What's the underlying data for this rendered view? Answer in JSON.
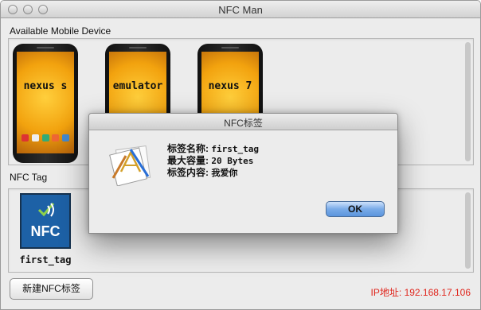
{
  "window": {
    "title": "NFC Man"
  },
  "devices": {
    "section_label": "Available Mobile Device",
    "items": [
      {
        "name": "nexus s"
      },
      {
        "name": "emulator"
      },
      {
        "name": "nexus 7"
      }
    ]
  },
  "tags": {
    "section_label": "NFC Tag",
    "items": [
      {
        "name": "first_tag",
        "icon_text": "NFC"
      }
    ]
  },
  "footer": {
    "new_tag_button": "新建NFC标签",
    "ip_label": "IP地址:",
    "ip_value": "192.168.17.106"
  },
  "dialog": {
    "title": "NFC标签",
    "rows": [
      {
        "key": "标签名称:",
        "value": "first_tag"
      },
      {
        "key": "最大容量:",
        "value": "20 Bytes"
      },
      {
        "key": "标签内容:",
        "value": "我爱你"
      }
    ],
    "ok_button": "OK"
  },
  "colors": {
    "accent_blue": "#5b95dd",
    "nfc_blue": "#1d61a6",
    "ip_red": "#e0261d"
  }
}
